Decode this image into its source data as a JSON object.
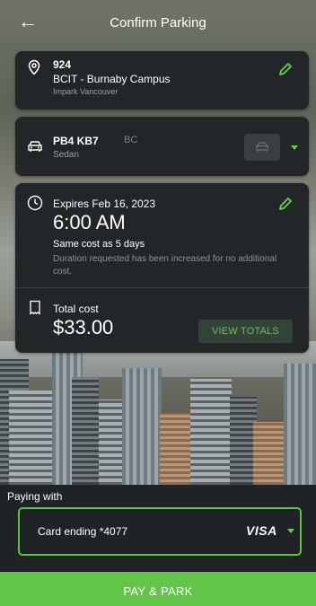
{
  "header": {
    "back_icon": "arrow-left-icon",
    "title": "Confirm Parking"
  },
  "location": {
    "icon": "location-pin-icon",
    "lot_number": "924",
    "name": "BCIT - Burnaby Campus",
    "operator": "Impark Vancouver",
    "edit_icon": "pencil-icon"
  },
  "vehicle": {
    "icon": "car-icon",
    "plate": "PB4 KB7",
    "province": "BC",
    "type": "Sedan",
    "button_icon": "car-icon",
    "dropdown_icon": "chevron-down-icon"
  },
  "duration": {
    "icon": "clock-icon",
    "expires_label": "Expires Feb 16, 2023",
    "time": "6:00 AM",
    "same_cost": "Same cost as 5 days",
    "note": "Duration requested has been increased for no additional cost.",
    "edit_icon": "pencil-icon"
  },
  "total": {
    "icon": "receipt-icon",
    "label": "Total cost",
    "amount": "$33.00",
    "view_totals": "VIEW TOTALS"
  },
  "payment": {
    "label": "Paying with",
    "card_text": "Card ending *4077",
    "brand": "VISA",
    "dropdown_icon": "chevron-down-icon"
  },
  "action": {
    "pay_label": "PAY & PARK"
  },
  "colors": {
    "accent": "#63c548",
    "card_bg": "#232628",
    "screen_bg": "#1f2325"
  }
}
